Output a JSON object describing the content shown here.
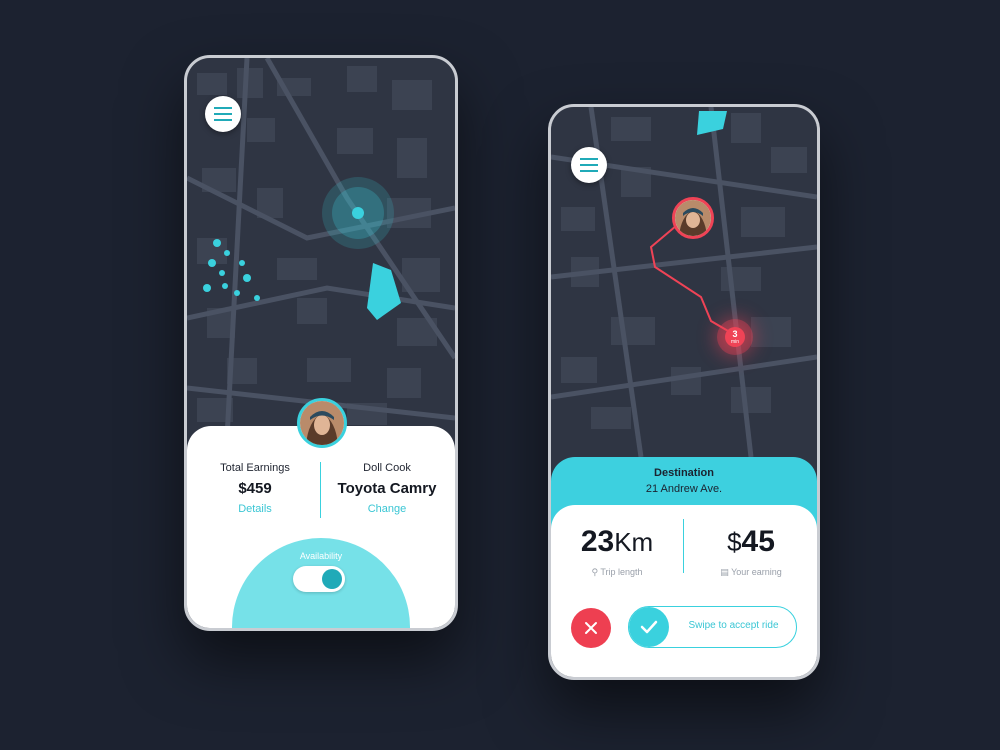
{
  "colors": {
    "accent": "#3ad1de",
    "accent_dark": "#20aab8",
    "danger": "#ef4356",
    "map_bg": "#2f3543",
    "page_bg": "#1c2230"
  },
  "left_screen": {
    "menu_icon": "hamburger-menu-icon",
    "earnings": {
      "label": "Total Earnings",
      "value": "$459",
      "link": "Details"
    },
    "vehicle": {
      "driver": "Doll Cook",
      "model": "Toyota Camry",
      "link": "Change"
    },
    "availability": {
      "label": "Availability",
      "on": true
    }
  },
  "right_screen": {
    "menu_icon": "hamburger-menu-icon",
    "eta_pin": {
      "value": "3",
      "unit": "min"
    },
    "destination": {
      "title": "Destination",
      "address": "21 Andrew Ave."
    },
    "trip": {
      "distance_value": "23",
      "distance_unit": "Km",
      "distance_label": "Trip length",
      "earning_symbol": "$",
      "earning_value": "45",
      "earning_label": "Your earning"
    },
    "actions": {
      "reject_icon": "close-icon",
      "accept_icon": "check-icon",
      "swipe_label": "Swipe to accept ride"
    }
  }
}
